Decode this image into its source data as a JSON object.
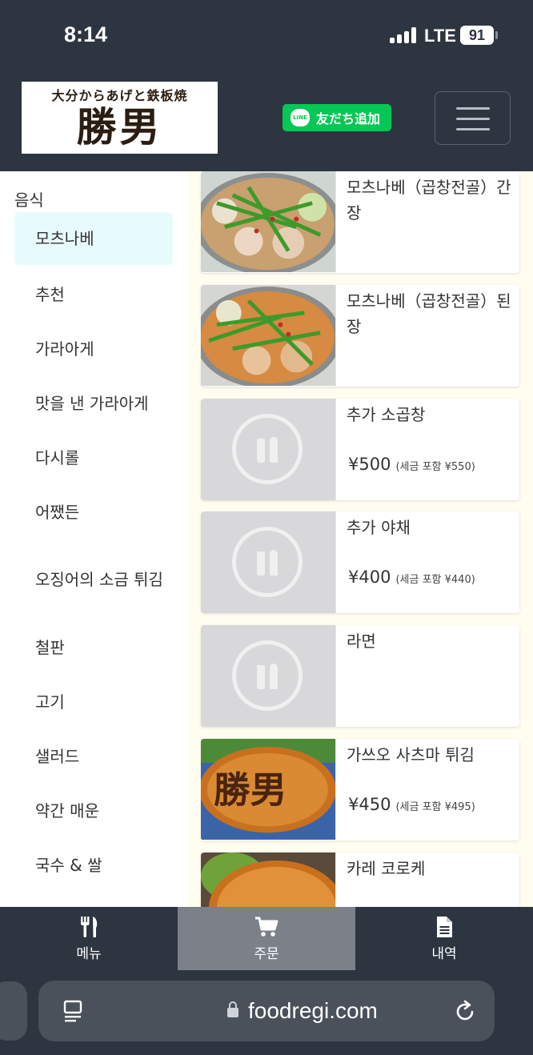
{
  "status_bar": {
    "time": "8:14",
    "network": "LTE",
    "battery": "91"
  },
  "header": {
    "logo_subtitle": "大分からあげと鉄板焼",
    "logo_title": "勝男",
    "line_button_icon": "LINE",
    "line_button_label": "友だち追加",
    "menu_icon": "hamburger-icon"
  },
  "sidebar": {
    "header": "음식",
    "categories": [
      {
        "label": "모츠나베",
        "active": true
      },
      {
        "label": "추천"
      },
      {
        "label": "가라아게"
      },
      {
        "label": "맛을 낸 가라아게"
      },
      {
        "label": "다시롤"
      },
      {
        "label": "어쨌든"
      },
      {
        "label": "오징어의 소금 튀김"
      },
      {
        "label": "철판"
      },
      {
        "label": "고기"
      },
      {
        "label": "샐러드"
      },
      {
        "label": "약간 매운"
      },
      {
        "label": "국수 & 쌀"
      }
    ]
  },
  "items": [
    {
      "name": "모츠나베（곱창전골）간장",
      "price": "",
      "tax": "",
      "image": "motsunabe-shoyu"
    },
    {
      "name": "모츠나베（곱창전골）된장",
      "price": "",
      "tax": "",
      "image": "motsunabe-miso"
    },
    {
      "name": "추가 소곱창",
      "price": "¥500",
      "tax": "(세금 포함 ¥550)",
      "image": "placeholder"
    },
    {
      "name": "추가 야채",
      "price": "¥400",
      "tax": "(세금 포함 ¥440)",
      "image": "placeholder"
    },
    {
      "name": "라면",
      "price": "",
      "tax": "",
      "image": "placeholder"
    },
    {
      "name": "가쓰오 사츠마 튀김",
      "price": "¥450",
      "tax": "(세금 포함 ¥495)",
      "image": "fried-cutlet-logo"
    },
    {
      "name": "카레 코로케",
      "price": "",
      "tax": "",
      "image": "curry-croquette"
    }
  ],
  "bottom_nav": [
    {
      "label": "메뉴",
      "icon": "fork-knife-icon",
      "active": false
    },
    {
      "label": "주문",
      "icon": "cart-icon",
      "active": true
    },
    {
      "label": "내역",
      "icon": "document-icon",
      "active": false
    }
  ],
  "browser": {
    "url": "foodregi.com"
  },
  "colors": {
    "brand_dark": "#2d3540",
    "line_green": "#06c755",
    "active_category": "#e8fbfc",
    "active_nav": "#7c8189"
  }
}
